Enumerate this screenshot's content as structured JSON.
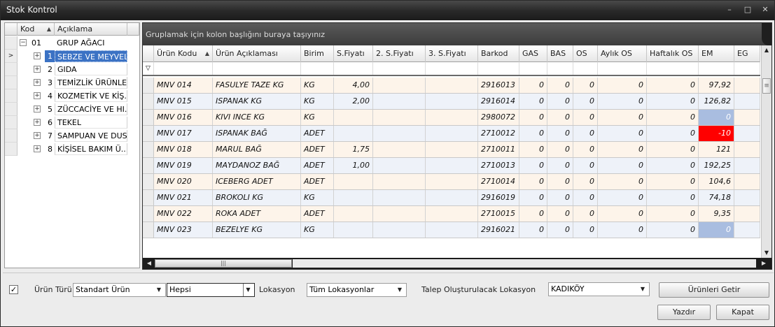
{
  "window": {
    "title": "Stok Kontrol",
    "min_glyph": "–",
    "max_glyph": "□",
    "close_glyph": "✕"
  },
  "tree": {
    "col_code": "Kod",
    "col_name": "Açıklama",
    "sort_glyph": "▲",
    "root": {
      "code": "01",
      "name": "GRUP AĞACI"
    },
    "items": [
      {
        "code": "1",
        "name": "SEBZE VE MEYVELER"
      },
      {
        "code": "2",
        "name": "GIDA"
      },
      {
        "code": "3",
        "name": "TEMİZLİK ÜRÜNLERİ"
      },
      {
        "code": "4",
        "name": "KOZMETİK VE KİŞ..."
      },
      {
        "code": "5",
        "name": "ZÜCCACİYE VE HI..."
      },
      {
        "code": "6",
        "name": "TEKEL"
      },
      {
        "code": "7",
        "name": "SAMPUAN VE DUS..."
      },
      {
        "code": "8",
        "name": "KİŞİSEL BAKIM Ü..."
      }
    ],
    "selected_glyph": ">",
    "expand_glyph": "+",
    "collapse_glyph": "−"
  },
  "grid": {
    "group_hint": "Gruplamak için kolon başlığını buraya taşıyınız",
    "columns": [
      "Ürün Kodu",
      "Ürün Açıklaması",
      "Birim",
      "S.Fiyatı",
      "2. S.Fiyatı",
      "3. S.Fiyatı",
      "Barkod",
      "GAS",
      "BAS",
      "OS",
      "Aylık OS",
      "Haftalık OS",
      "EM",
      "EG"
    ],
    "sort_glyph": "▲",
    "filter_glyph": "▽",
    "rows": [
      [
        "MNV 014",
        "FASULYE TAZE KG",
        "KG",
        "4,00",
        "",
        "",
        "2916013",
        "0",
        "0",
        "0",
        "0",
        "0",
        "97,92",
        ""
      ],
      [
        "MNV 015",
        "ISPANAK  KG",
        "KG",
        "2,00",
        "",
        "",
        "2916014",
        "0",
        "0",
        "0",
        "0",
        "0",
        "126,82",
        ""
      ],
      [
        "MNV 016",
        "KIVI INCE KG",
        "KG",
        "",
        "",
        "",
        "2980072",
        "0",
        "0",
        "0",
        "0",
        "0",
        "0",
        ""
      ],
      [
        "MNV 017",
        "ISPANAK BAĞ",
        "ADET",
        "",
        "",
        "",
        "2710012",
        "0",
        "0",
        "0",
        "0",
        "0",
        "-10",
        ""
      ],
      [
        "MNV 018",
        "MARUL BAĞ",
        "ADET",
        "1,75",
        "",
        "",
        "2710011",
        "0",
        "0",
        "0",
        "0",
        "0",
        "121",
        ""
      ],
      [
        "MNV 019",
        "MAYDANOZ BAĞ",
        "ADET",
        "1,00",
        "",
        "",
        "2710013",
        "0",
        "0",
        "0",
        "0",
        "0",
        "192,25",
        ""
      ],
      [
        "MNV 020",
        "ICEBERG ADET",
        "ADET",
        "",
        "",
        "",
        "2710014",
        "0",
        "0",
        "0",
        "0",
        "0",
        "104,6",
        ""
      ],
      [
        "MNV 021",
        "BROKOLI KG",
        "KG",
        "",
        "",
        "",
        "2916019",
        "0",
        "0",
        "0",
        "0",
        "0",
        "74,18",
        ""
      ],
      [
        "MNV 022",
        "ROKA ADET",
        "ADET",
        "",
        "",
        "",
        "2710015",
        "0",
        "0",
        "0",
        "0",
        "0",
        "9,35",
        ""
      ],
      [
        "MNV 023",
        "BEZELYE  KG",
        "KG",
        "",
        "",
        "",
        "2916021",
        "0",
        "0",
        "0",
        "0",
        "0",
        "0",
        ""
      ]
    ],
    "em_colors": {
      "zero": "#a9bde0",
      "negative": "#ff0000"
    },
    "scroll_up": "▲",
    "scroll_down": "▼",
    "scroll_left": "◀",
    "scroll_right": "▶",
    "thumb_grip": "|||",
    "vthumb_grip": "≡"
  },
  "bottom": {
    "check_glyph": "✓",
    "urun_turu_label": "Ürün Türü",
    "urun_turu_value": "Standart Ürün",
    "hepsi_value": "Hepsi",
    "lokasyon_label": "Lokasyon",
    "lokasyon_value": "Tüm Lokasyonlar",
    "talep_label": "Talep Oluşturulacak Lokasyon",
    "talep_value": "KADIKÖY",
    "dropdown_glyph": "▼",
    "getir_button": "Ürünleri Getir",
    "yazdir_button": "Yazdır",
    "kapat_button": "Kapat"
  }
}
